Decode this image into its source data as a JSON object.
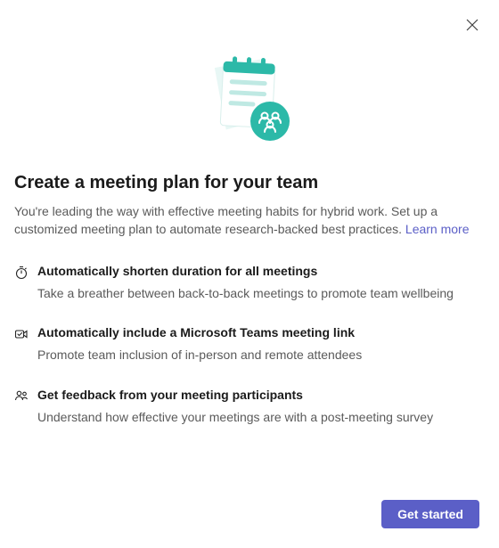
{
  "dialog": {
    "close_label": "Close"
  },
  "header": {
    "title": "Create a meeting plan for your team",
    "description": "You're leading the way with effective meeting habits for hybrid work. Set up a customized meeting plan to automate research-backed best practices. ",
    "learn_more_label": "Learn more"
  },
  "features": [
    {
      "icon": "timer-icon",
      "title": "Automatically shorten duration for all meetings",
      "description": "Take a breather between back-to-back meetings to promote team wellbeing"
    },
    {
      "icon": "video-link-icon",
      "title": "Automatically include a Microsoft Teams meeting link",
      "description": "Promote team inclusion of in-person and remote attendees"
    },
    {
      "icon": "feedback-icon",
      "title": "Get feedback from your meeting participants",
      "description": "Understand how effective your meetings are with a post-meeting survey"
    }
  ],
  "footer": {
    "primary_button_label": "Get started"
  },
  "colors": {
    "accent": "#5b5fc7",
    "teal": "#2cb9a8"
  }
}
